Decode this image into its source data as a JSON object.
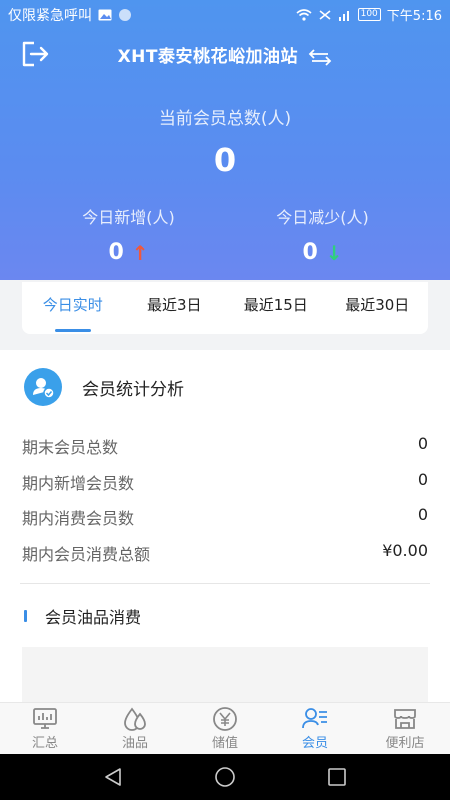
{
  "status_bar": {
    "carrier_text": "仅限紧急呼叫",
    "battery": "100",
    "time": "下午5:16"
  },
  "header": {
    "station_name": "XHT泰安桃花峪加油站",
    "total_label": "当前会员总数(人)",
    "total_value": "0",
    "today_new_label": "今日新增(人)",
    "today_new_value": "0",
    "today_reduce_label": "今日减少(人)",
    "today_reduce_value": "0",
    "up_arrow": "↑",
    "down_arrow": "↓"
  },
  "tabs": [
    {
      "label": "今日实时",
      "active": true
    },
    {
      "label": "最近3日",
      "active": false
    },
    {
      "label": "最近15日",
      "active": false
    },
    {
      "label": "最近30日",
      "active": false
    }
  ],
  "analysis": {
    "title": "会员统计分析",
    "rows": [
      {
        "label": "期末会员总数",
        "value": "0"
      },
      {
        "label": "期内新增会员数",
        "value": "0"
      },
      {
        "label": "期内消费会员数",
        "value": "0"
      },
      {
        "label": "期内会员消费总额",
        "value": "¥0.00"
      }
    ]
  },
  "oil_section": {
    "title": "会员油品消费"
  },
  "bottom_nav": [
    {
      "label": "汇总",
      "icon": "summary-icon",
      "active": false
    },
    {
      "label": "油品",
      "icon": "oil-drop-icon",
      "active": false
    },
    {
      "label": "储值",
      "icon": "yen-icon",
      "active": false
    },
    {
      "label": "会员",
      "icon": "member-icon",
      "active": true
    },
    {
      "label": "便利店",
      "icon": "store-icon",
      "active": false
    }
  ],
  "colors": {
    "header_blue": "#5b8cf0",
    "accent": "#3a8ee6",
    "up": "#f0583c",
    "down": "#2fcf7d"
  }
}
